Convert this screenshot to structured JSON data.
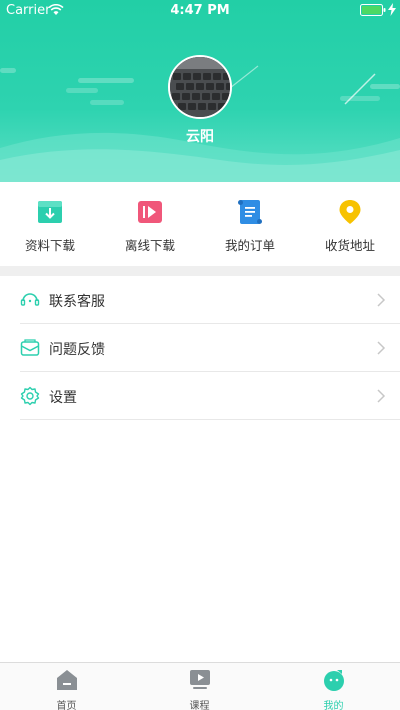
{
  "status_bar": {
    "carrier": "Carrier",
    "time": "4:47 PM"
  },
  "profile": {
    "username": "云阳"
  },
  "shortcuts": [
    {
      "label": "资料下载",
      "icon": "download-box-icon",
      "color": "#2ccfae"
    },
    {
      "label": "离线下载",
      "icon": "video-play-icon",
      "color": "#f0577a"
    },
    {
      "label": "我的订单",
      "icon": "order-scroll-icon",
      "color": "#2f8de4"
    },
    {
      "label": "收货地址",
      "icon": "location-pin-icon",
      "color": "#f7c200"
    }
  ],
  "menu": [
    {
      "label": "联系客服",
      "icon": "headset-icon"
    },
    {
      "label": "问题反馈",
      "icon": "feedback-mail-icon"
    },
    {
      "label": "设置",
      "icon": "settings-gear-icon"
    }
  ],
  "tabbar": {
    "active_index": 2,
    "tabs": [
      {
        "label": "首页",
        "icon": "home-icon"
      },
      {
        "label": "课程",
        "icon": "course-play-icon"
      },
      {
        "label": "我的",
        "icon": "profile-face-icon"
      }
    ]
  },
  "colors": {
    "accent": "#2ccfae",
    "header": "#22cfa6"
  }
}
